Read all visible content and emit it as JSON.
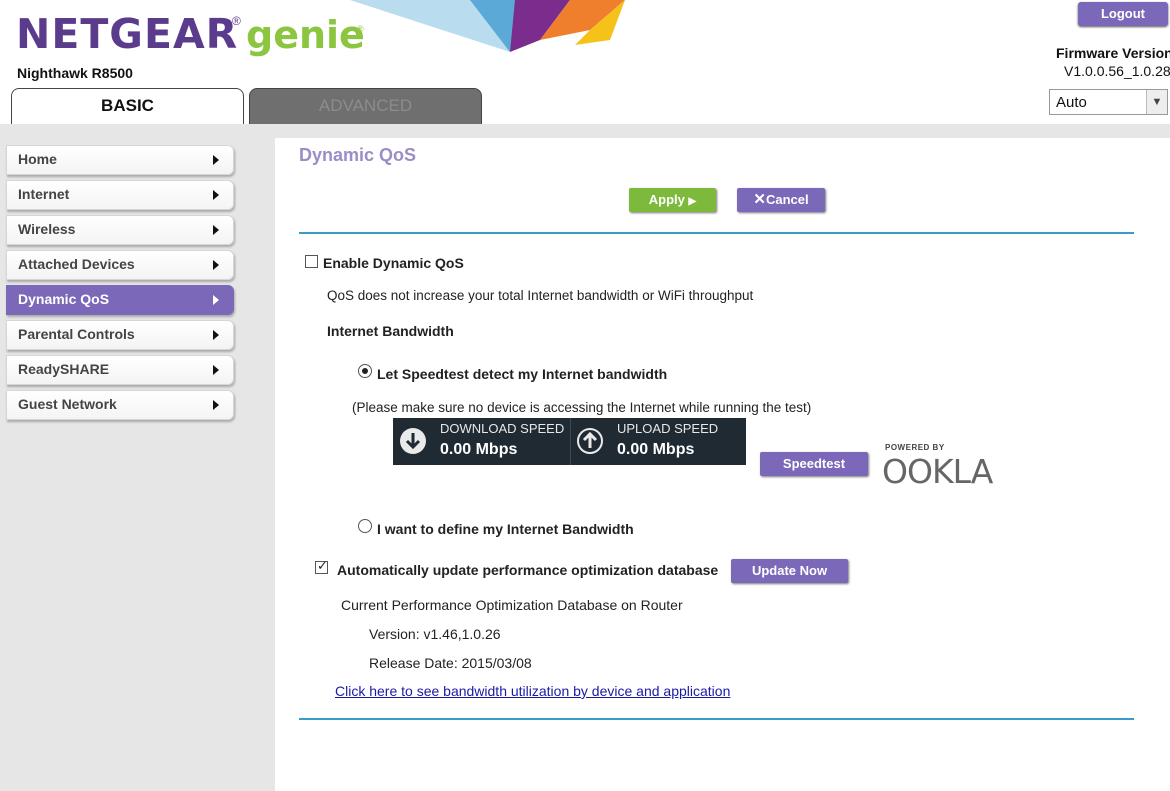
{
  "header": {
    "brand": "NETGEAR",
    "brand_mark": "®",
    "product": "genie",
    "product_mark": "®",
    "model": "Nighthawk R8500",
    "logout_label": "Logout",
    "firmware_label": "Firmware Version",
    "firmware_value": "V1.0.0.56_1.0.28",
    "language_select": {
      "value": "Auto"
    },
    "tabs": [
      {
        "label": "BASIC",
        "active": true
      },
      {
        "label": "ADVANCED",
        "active": false
      }
    ]
  },
  "sidebar": {
    "items": [
      {
        "label": "Home"
      },
      {
        "label": "Internet"
      },
      {
        "label": "Wireless"
      },
      {
        "label": "Attached Devices"
      },
      {
        "label": "Dynamic QoS",
        "active": true
      },
      {
        "label": "Parental Controls"
      },
      {
        "label": "ReadySHARE"
      },
      {
        "label": "Guest Network"
      }
    ]
  },
  "main": {
    "title": "Dynamic QoS",
    "apply_label": "Apply",
    "cancel_label": "Cancel",
    "enable_qos_label": "Enable Dynamic QoS",
    "enable_qos_checked": false,
    "qos_note": "QoS does not increase your total Internet bandwidth or WiFi throughput",
    "bandwidth_heading": "Internet Bandwidth",
    "option_speedtest_label": "Let Speedtest detect my Internet bandwidth",
    "option_speedtest_selected": true,
    "speedtest_note": "(Please make sure no device is accessing the Internet while running the test)",
    "download_title": "DOWNLOAD SPEED",
    "download_value": "0.00 Mbps",
    "upload_title": "UPLOAD SPEED",
    "upload_value": "0.00 Mbps",
    "speedtest_button": "Speedtest",
    "ookla_powered": "POWERED BY",
    "ookla_name": "OOKLA",
    "option_manual_label": "I want to define my Internet Bandwidth",
    "option_manual_selected": false,
    "auto_update_label": "Automatically update performance optimization database",
    "auto_update_checked": true,
    "update_now_label": "Update Now",
    "db_heading": "Current Performance Optimization Database on Router",
    "db_version": "Version: v1.46,1.0.26",
    "db_release": "Release Date: 2015/03/08",
    "utilization_link": "Click here to see bandwidth utilization by device and application"
  },
  "colors": {
    "brand_purple": "#5b3c8c",
    "genie_green": "#8cc53f",
    "accent_purple": "#7b68b9",
    "apply_green": "#7dba3c",
    "rule_blue": "#3a9bc4",
    "title_lavender": "#9b8dc6"
  }
}
